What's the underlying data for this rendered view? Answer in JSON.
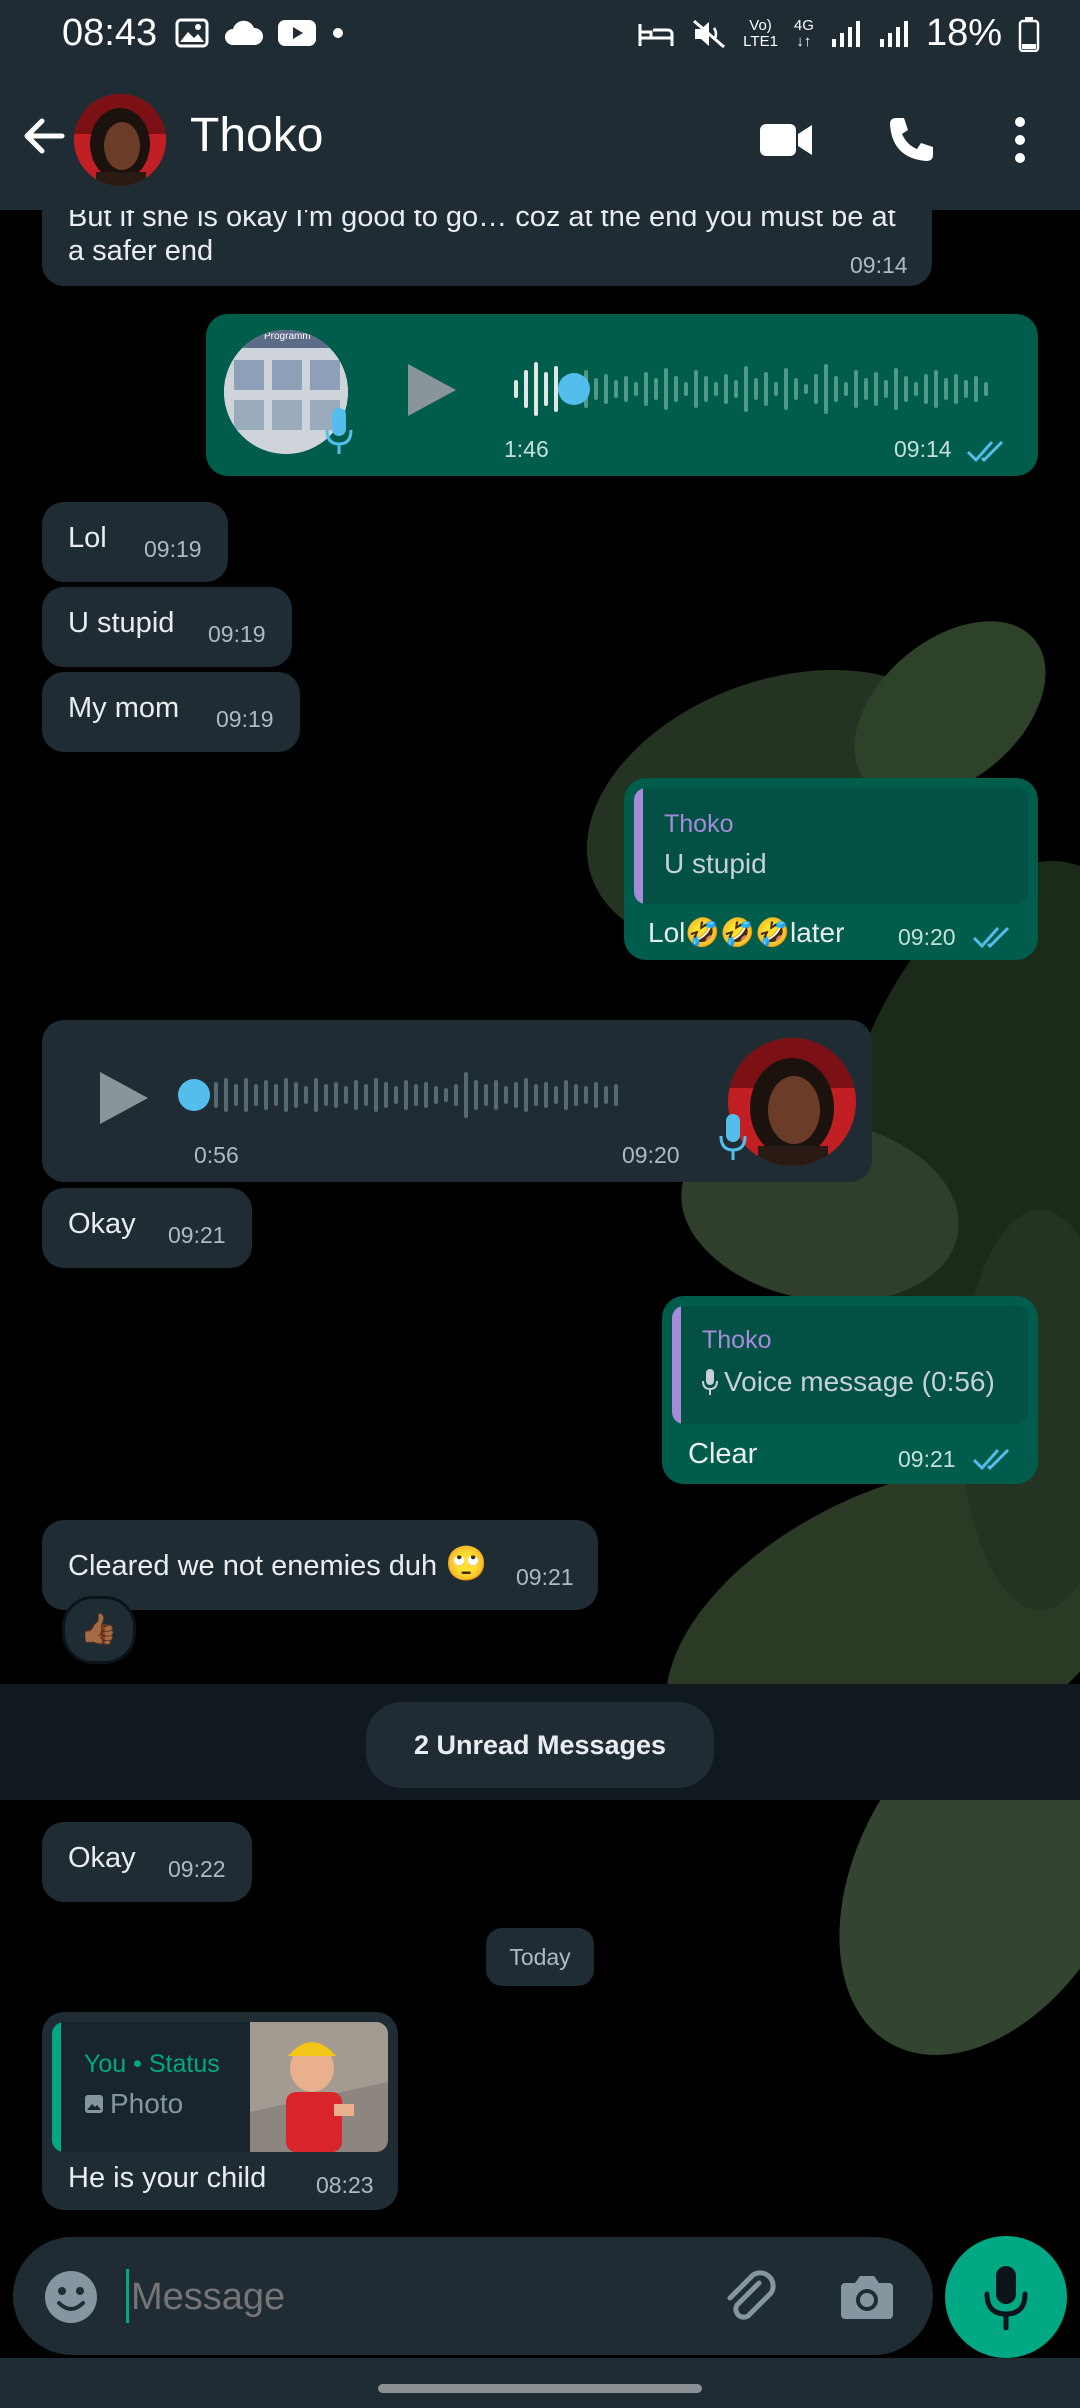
{
  "status_bar": {
    "time": "08:43",
    "net_top": "Vo)",
    "net_bottom": "LTE1",
    "net_type": "4G",
    "battery": "18%"
  },
  "header": {
    "contact_name": "Thoko",
    "icons": [
      "back-arrow-icon",
      "video-call-icon",
      "phone-icon",
      "more-vert-icon"
    ]
  },
  "messages": {
    "m1": {
      "text": "But if she is okay I'm good to go… coz at the end you must be at a safer end",
      "time": "09:14"
    },
    "m2": {
      "duration": "1:46",
      "time": "09:14",
      "thumb_text": "Programm"
    },
    "m3": {
      "text": "Lol",
      "time": "09:19"
    },
    "m4": {
      "text": "U stupid",
      "time": "09:19"
    },
    "m5": {
      "text": "My mom",
      "time": "09:19"
    },
    "m6": {
      "quote_name": "Thoko",
      "quote_text": "U stupid",
      "text_a": "Lol",
      "emoji": "🤣🤣🤣",
      "text_b": "later",
      "time": "09:20"
    },
    "m7": {
      "duration": "0:56",
      "time": "09:20"
    },
    "m8": {
      "text": "Okay",
      "time": "09:21"
    },
    "m9": {
      "quote_name": "Thoko",
      "quote_text": "Voice message (0:56)",
      "text": "Clear",
      "time": "09:21"
    },
    "m10": {
      "text": "Cleared we not enemies duh",
      "emoji": "🙄",
      "time": "09:21",
      "reaction": "👍🏾"
    },
    "unread": "2 Unread Messages",
    "m11": {
      "text": "Okay",
      "time": "09:22"
    },
    "date_chip": "Today",
    "m12": {
      "quote_name": "You",
      "quote_dot": "•",
      "quote_source": "Status",
      "quote_text": "Photo",
      "text": "He is your child",
      "time": "08:23"
    }
  },
  "composer": {
    "placeholder": "Message"
  },
  "colors": {
    "header": "#1f2c34",
    "incoming": "#1f2c34",
    "outgoing": "#005c4b",
    "accent": "#00a884",
    "read_ticks": "#53bdeb"
  }
}
